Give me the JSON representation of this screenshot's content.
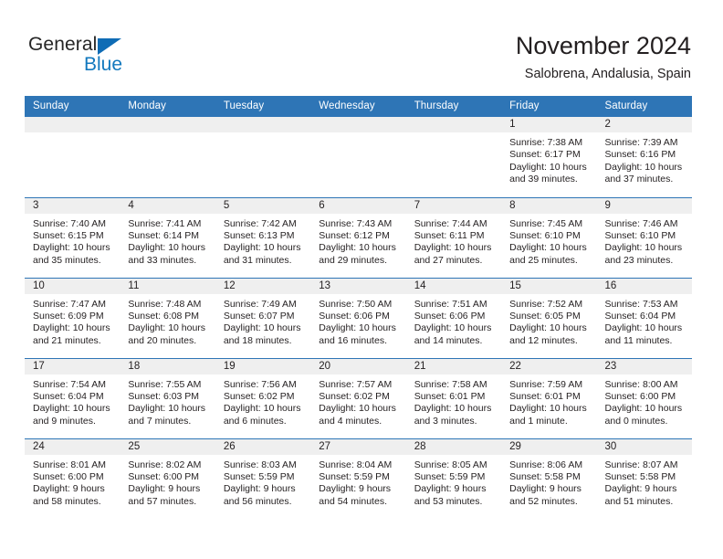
{
  "brand": {
    "line1": "General",
    "line2": "Blue",
    "triangle_color": "#0f6cb5",
    "blue_text_color": "#1278be"
  },
  "header": {
    "title": "November 2024",
    "subtitle": "Salobrena, Andalusia, Spain"
  },
  "theme": {
    "header_blue": "#2e75b6",
    "daynum_band": "#efefef",
    "text": "#231f20",
    "row_divider": "#2e75b6"
  },
  "weekday_headers": [
    "Sunday",
    "Monday",
    "Tuesday",
    "Wednesday",
    "Thursday",
    "Friday",
    "Saturday"
  ],
  "weeks": [
    [
      {
        "day": ""
      },
      {
        "day": ""
      },
      {
        "day": ""
      },
      {
        "day": ""
      },
      {
        "day": ""
      },
      {
        "day": "1",
        "sunrise": "Sunrise: 7:38 AM",
        "sunset": "Sunset: 6:17 PM",
        "daylight": "Daylight: 10 hours and 39 minutes."
      },
      {
        "day": "2",
        "sunrise": "Sunrise: 7:39 AM",
        "sunset": "Sunset: 6:16 PM",
        "daylight": "Daylight: 10 hours and 37 minutes."
      }
    ],
    [
      {
        "day": "3",
        "sunrise": "Sunrise: 7:40 AM",
        "sunset": "Sunset: 6:15 PM",
        "daylight": "Daylight: 10 hours and 35 minutes."
      },
      {
        "day": "4",
        "sunrise": "Sunrise: 7:41 AM",
        "sunset": "Sunset: 6:14 PM",
        "daylight": "Daylight: 10 hours and 33 minutes."
      },
      {
        "day": "5",
        "sunrise": "Sunrise: 7:42 AM",
        "sunset": "Sunset: 6:13 PM",
        "daylight": "Daylight: 10 hours and 31 minutes."
      },
      {
        "day": "6",
        "sunrise": "Sunrise: 7:43 AM",
        "sunset": "Sunset: 6:12 PM",
        "daylight": "Daylight: 10 hours and 29 minutes."
      },
      {
        "day": "7",
        "sunrise": "Sunrise: 7:44 AM",
        "sunset": "Sunset: 6:11 PM",
        "daylight": "Daylight: 10 hours and 27 minutes."
      },
      {
        "day": "8",
        "sunrise": "Sunrise: 7:45 AM",
        "sunset": "Sunset: 6:10 PM",
        "daylight": "Daylight: 10 hours and 25 minutes."
      },
      {
        "day": "9",
        "sunrise": "Sunrise: 7:46 AM",
        "sunset": "Sunset: 6:10 PM",
        "daylight": "Daylight: 10 hours and 23 minutes."
      }
    ],
    [
      {
        "day": "10",
        "sunrise": "Sunrise: 7:47 AM",
        "sunset": "Sunset: 6:09 PM",
        "daylight": "Daylight: 10 hours and 21 minutes."
      },
      {
        "day": "11",
        "sunrise": "Sunrise: 7:48 AM",
        "sunset": "Sunset: 6:08 PM",
        "daylight": "Daylight: 10 hours and 20 minutes."
      },
      {
        "day": "12",
        "sunrise": "Sunrise: 7:49 AM",
        "sunset": "Sunset: 6:07 PM",
        "daylight": "Daylight: 10 hours and 18 minutes."
      },
      {
        "day": "13",
        "sunrise": "Sunrise: 7:50 AM",
        "sunset": "Sunset: 6:06 PM",
        "daylight": "Daylight: 10 hours and 16 minutes."
      },
      {
        "day": "14",
        "sunrise": "Sunrise: 7:51 AM",
        "sunset": "Sunset: 6:06 PM",
        "daylight": "Daylight: 10 hours and 14 minutes."
      },
      {
        "day": "15",
        "sunrise": "Sunrise: 7:52 AM",
        "sunset": "Sunset: 6:05 PM",
        "daylight": "Daylight: 10 hours and 12 minutes."
      },
      {
        "day": "16",
        "sunrise": "Sunrise: 7:53 AM",
        "sunset": "Sunset: 6:04 PM",
        "daylight": "Daylight: 10 hours and 11 minutes."
      }
    ],
    [
      {
        "day": "17",
        "sunrise": "Sunrise: 7:54 AM",
        "sunset": "Sunset: 6:04 PM",
        "daylight": "Daylight: 10 hours and 9 minutes."
      },
      {
        "day": "18",
        "sunrise": "Sunrise: 7:55 AM",
        "sunset": "Sunset: 6:03 PM",
        "daylight": "Daylight: 10 hours and 7 minutes."
      },
      {
        "day": "19",
        "sunrise": "Sunrise: 7:56 AM",
        "sunset": "Sunset: 6:02 PM",
        "daylight": "Daylight: 10 hours and 6 minutes."
      },
      {
        "day": "20",
        "sunrise": "Sunrise: 7:57 AM",
        "sunset": "Sunset: 6:02 PM",
        "daylight": "Daylight: 10 hours and 4 minutes."
      },
      {
        "day": "21",
        "sunrise": "Sunrise: 7:58 AM",
        "sunset": "Sunset: 6:01 PM",
        "daylight": "Daylight: 10 hours and 3 minutes."
      },
      {
        "day": "22",
        "sunrise": "Sunrise: 7:59 AM",
        "sunset": "Sunset: 6:01 PM",
        "daylight": "Daylight: 10 hours and 1 minute."
      },
      {
        "day": "23",
        "sunrise": "Sunrise: 8:00 AM",
        "sunset": "Sunset: 6:00 PM",
        "daylight": "Daylight: 10 hours and 0 minutes."
      }
    ],
    [
      {
        "day": "24",
        "sunrise": "Sunrise: 8:01 AM",
        "sunset": "Sunset: 6:00 PM",
        "daylight": "Daylight: 9 hours and 58 minutes."
      },
      {
        "day": "25",
        "sunrise": "Sunrise: 8:02 AM",
        "sunset": "Sunset: 6:00 PM",
        "daylight": "Daylight: 9 hours and 57 minutes."
      },
      {
        "day": "26",
        "sunrise": "Sunrise: 8:03 AM",
        "sunset": "Sunset: 5:59 PM",
        "daylight": "Daylight: 9 hours and 56 minutes."
      },
      {
        "day": "27",
        "sunrise": "Sunrise: 8:04 AM",
        "sunset": "Sunset: 5:59 PM",
        "daylight": "Daylight: 9 hours and 54 minutes."
      },
      {
        "day": "28",
        "sunrise": "Sunrise: 8:05 AM",
        "sunset": "Sunset: 5:59 PM",
        "daylight": "Daylight: 9 hours and 53 minutes."
      },
      {
        "day": "29",
        "sunrise": "Sunrise: 8:06 AM",
        "sunset": "Sunset: 5:58 PM",
        "daylight": "Daylight: 9 hours and 52 minutes."
      },
      {
        "day": "30",
        "sunrise": "Sunrise: 8:07 AM",
        "sunset": "Sunset: 5:58 PM",
        "daylight": "Daylight: 9 hours and 51 minutes."
      }
    ]
  ]
}
